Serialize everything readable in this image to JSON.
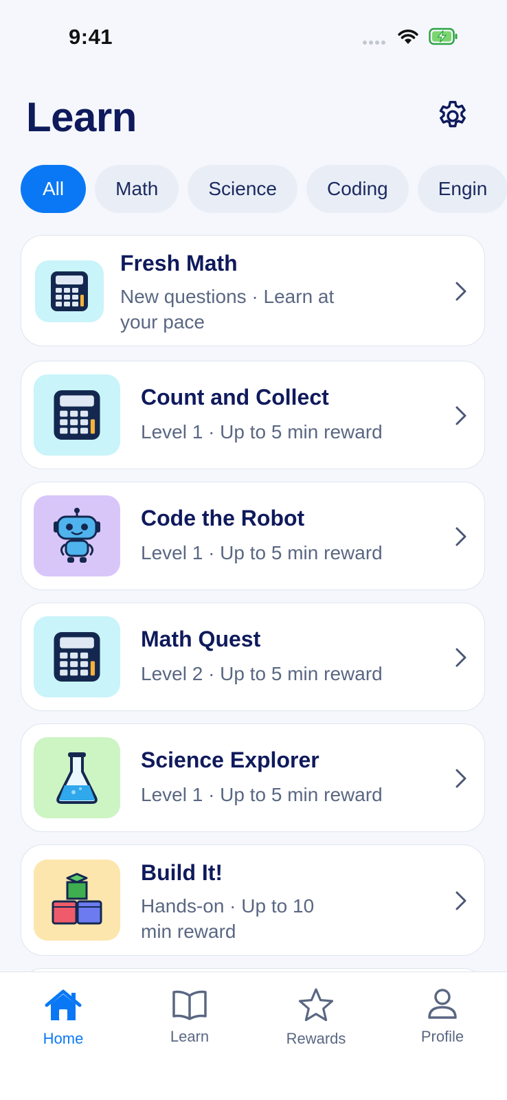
{
  "status_bar": {
    "time": "9:41"
  },
  "header": {
    "title": "Learn"
  },
  "filters": {
    "chips": [
      {
        "label": "All",
        "active": true
      },
      {
        "label": "Math",
        "active": false
      },
      {
        "label": "Science",
        "active": false
      },
      {
        "label": "Coding",
        "active": false
      },
      {
        "label": "Engin",
        "active": false
      }
    ]
  },
  "activities": [
    {
      "title": "Fresh Math",
      "subtitle": "New questions · Learn at your pace",
      "icon": "calculator-icon",
      "icon_bg": "#c9f4f9"
    },
    {
      "title": "Count and Collect",
      "subtitle": "Level 1 · Up to 5 min reward",
      "icon": "calculator-icon",
      "icon_bg": "#c9f4f9"
    },
    {
      "title": "Code the Robot",
      "subtitle": "Level 1 · Up to 5 min reward",
      "icon": "robot-icon",
      "icon_bg": "#d9c6f9"
    },
    {
      "title": "Math Quest",
      "subtitle": "Level 2 · Up to 5 min reward",
      "icon": "calculator-icon",
      "icon_bg": "#c9f4f9"
    },
    {
      "title": "Science Explorer",
      "subtitle": "Level 1 · Up to 5 min reward",
      "icon": "flask-icon",
      "icon_bg": "#cdf4c3"
    },
    {
      "title": "Build It!",
      "subtitle": "Hands-on · Up to 10 min reward",
      "icon": "blocks-icon",
      "icon_bg": "#fde6ad"
    }
  ],
  "tab_bar": {
    "tabs": [
      {
        "label": "Home",
        "icon": "home-icon",
        "active": true
      },
      {
        "label": "Learn",
        "icon": "book-icon",
        "active": false
      },
      {
        "label": "Rewards",
        "icon": "star-icon",
        "active": false
      },
      {
        "label": "Profile",
        "icon": "person-icon",
        "active": false
      }
    ]
  },
  "colors": {
    "accent": "#0a78f5",
    "title": "#0f1a5c",
    "subtitle": "#5a6782",
    "background": "#f5f7fc"
  }
}
